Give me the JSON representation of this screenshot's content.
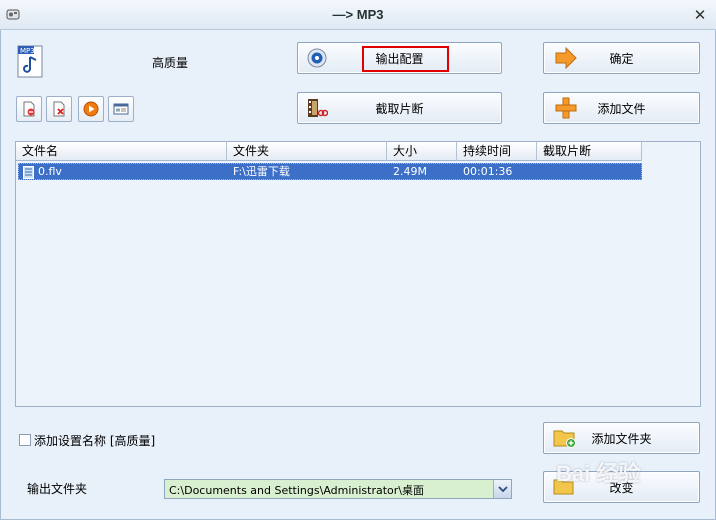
{
  "window": {
    "title": "—> MP3"
  },
  "profile": {
    "quality": "高质量"
  },
  "buttons": {
    "output_config": "输出配置",
    "ok": "确定",
    "clip": "截取片断",
    "add_file": "添加文件",
    "add_folder": "添加文件夹",
    "change": "改变"
  },
  "table": {
    "columns": [
      "文件名",
      "文件夹",
      "大小",
      "持续时间",
      "截取片断"
    ],
    "rows": [
      {
        "name": "0.flv",
        "folder": "F:\\迅雷下载",
        "size": "2.49M",
        "duration": "00:01:36",
        "clip": ""
      }
    ]
  },
  "options": {
    "add_setting_name": "添加设置名称 [高质量]",
    "add_setting_checked": false
  },
  "output": {
    "label": "输出文件夹",
    "path": "C:\\Documents and Settings\\Administrator\\桌面"
  },
  "watermark": "Bai 经验",
  "colors": {
    "selection": "#3c6fc7",
    "highlight": "#e00000",
    "path_bg": "#d8f0cf"
  }
}
